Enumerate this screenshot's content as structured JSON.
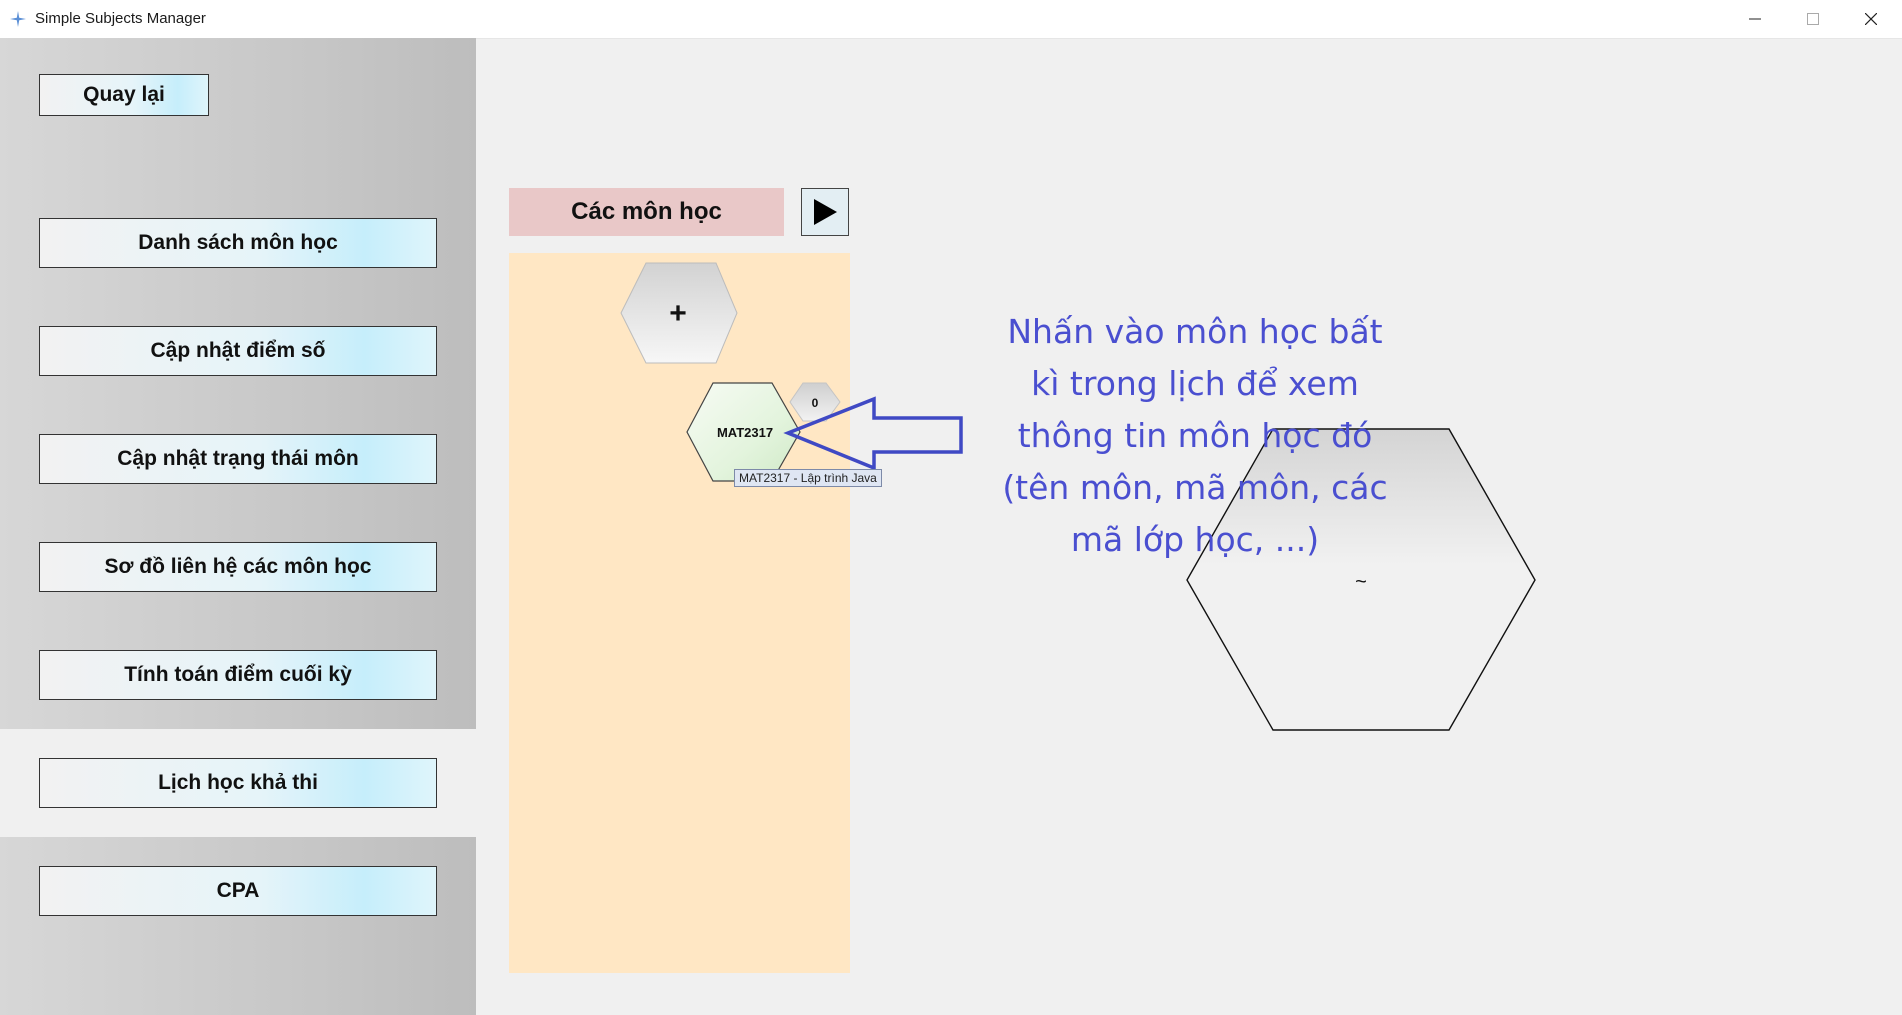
{
  "window": {
    "title": "Simple Subjects Manager",
    "controls": [
      "minimize",
      "maximize",
      "close"
    ]
  },
  "sidebar": {
    "back_label": "Quay lại",
    "items": [
      {
        "label": "Danh sách môn học"
      },
      {
        "label": "Cập nhật điểm số"
      },
      {
        "label": "Cập nhật trạng thái môn"
      },
      {
        "label": "Sơ đồ liên hệ các môn học"
      },
      {
        "label": "Tính toán điểm cuối kỳ"
      },
      {
        "label": "Lịch học khả thi",
        "selected": true
      },
      {
        "label": "CPA"
      }
    ]
  },
  "main": {
    "header": "Các môn học",
    "play_icon": "play-icon",
    "add_label": "+",
    "subject": {
      "code": "MAT2317",
      "badge": "0",
      "tooltip": "MAT2317 - Lập trình Java"
    },
    "hint_lines": [
      "Nhấn vào môn học bất",
      "kì trong lịch để xem",
      "thông tin môn học đó",
      "(tên môn, mã môn, các",
      "mã lớp học, ...)"
    ],
    "detail_hex_text": "~"
  },
  "colors": {
    "sidebar": "#c9c9c9",
    "header": "#e9c8c8",
    "panel": "#ffe7c4",
    "hint": "#4a4fd0",
    "arrow": "#3f49c4"
  }
}
